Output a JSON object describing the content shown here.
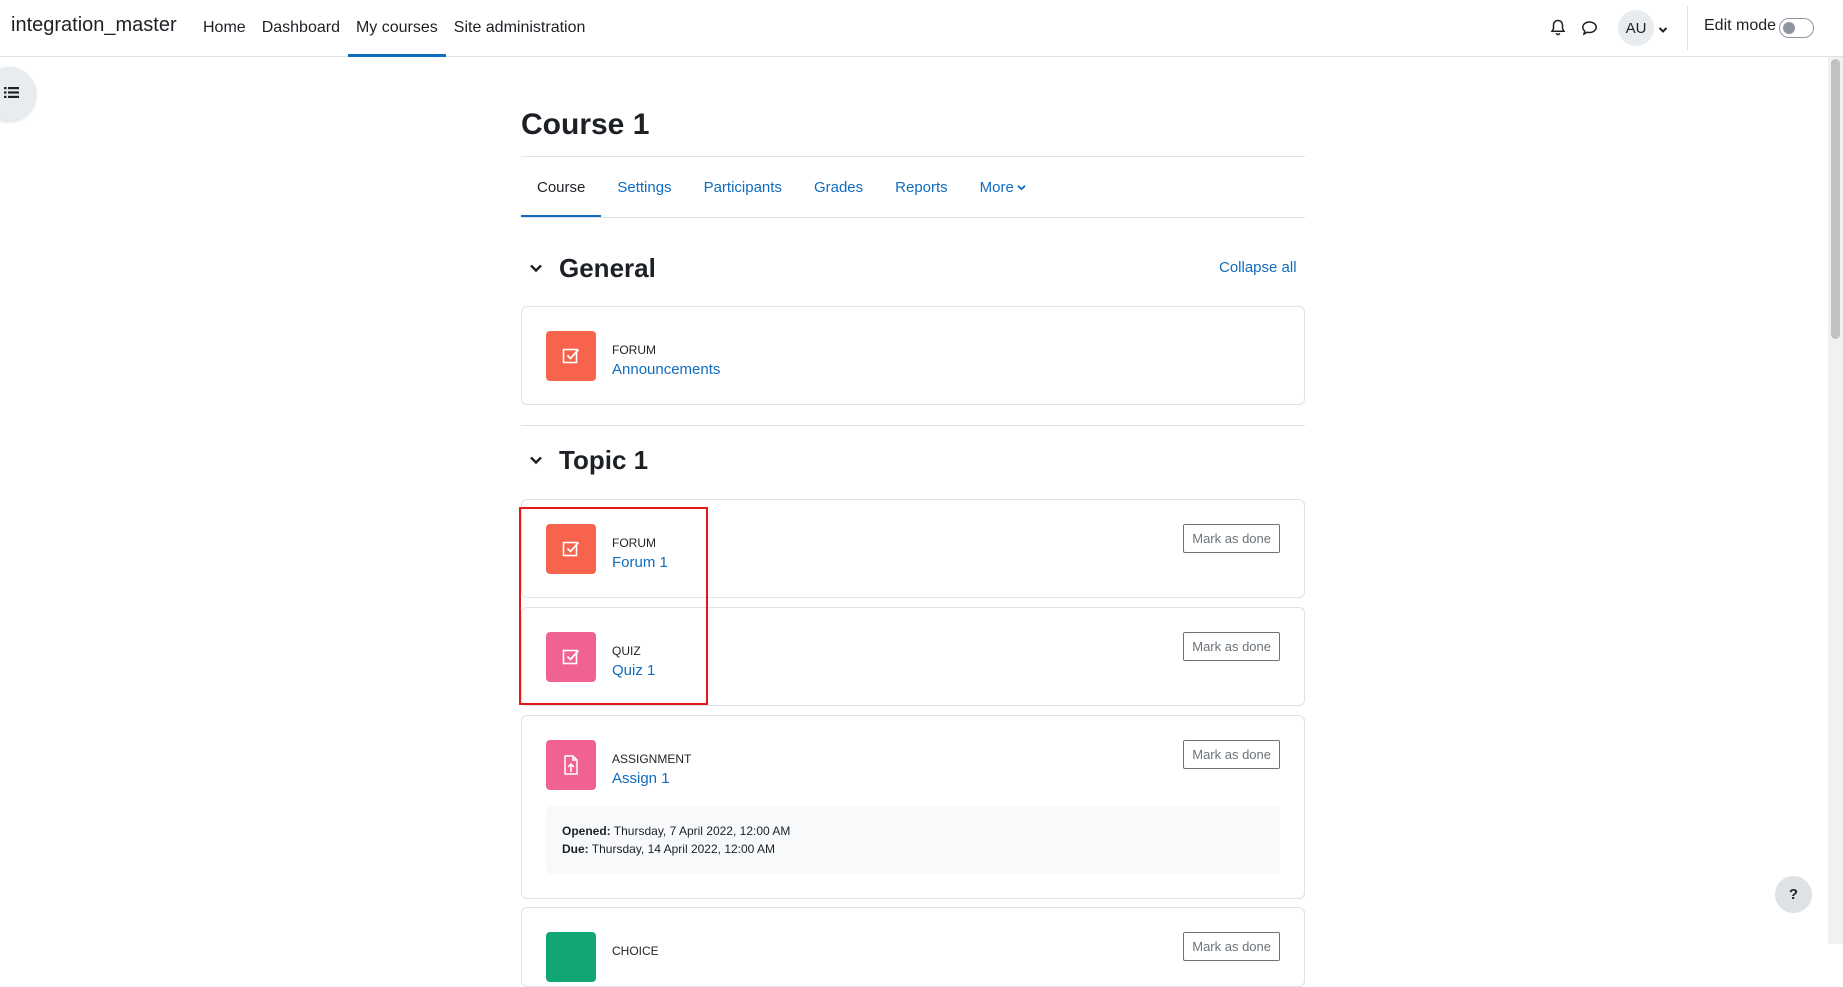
{
  "navbar": {
    "brand": "integration_master",
    "items": [
      {
        "label": "Home",
        "active": false
      },
      {
        "label": "Dashboard",
        "active": false
      },
      {
        "label": "My courses",
        "active": true
      },
      {
        "label": "Site administration",
        "active": false
      }
    ],
    "avatar_initials": "AU",
    "edit_mode_label": "Edit mode",
    "edit_mode_on": false,
    "icons": [
      "bell-icon",
      "chat-icon",
      "chevron-down-icon"
    ]
  },
  "course": {
    "title": "Course 1",
    "tabs": [
      {
        "label": "Course",
        "active": true
      },
      {
        "label": "Settings",
        "active": false
      },
      {
        "label": "Participants",
        "active": false
      },
      {
        "label": "Grades",
        "active": false
      },
      {
        "label": "Reports",
        "active": false
      },
      {
        "label": "More",
        "active": false
      }
    ]
  },
  "collapse_all_label": "Collapse all",
  "sections": [
    {
      "title": "General",
      "activities": [
        {
          "type": "FORUM",
          "name": "Announcements",
          "icon": "forum-icon",
          "color": "#f7634d"
        }
      ]
    },
    {
      "title": "Topic 1",
      "activities": [
        {
          "type": "FORUM",
          "name": "Forum 1",
          "icon": "forum-icon",
          "color": "#f7634d",
          "button": "Mark as done"
        },
        {
          "type": "QUIZ",
          "name": "Quiz 1",
          "icon": "quiz-icon",
          "color": "#f06292",
          "button": "Mark as done"
        },
        {
          "type": "ASSIGNMENT",
          "name": "Assign 1",
          "icon": "assignment-icon",
          "color": "#f06292",
          "button": "Mark as done",
          "dates": {
            "opened_label": "Opened:",
            "opened": "Thursday, 7 April 2022, 12:00 AM",
            "due_label": "Due:",
            "due": "Thursday, 14 April 2022, 12:00 AM"
          }
        },
        {
          "type": "CHOICE",
          "name": "",
          "icon": "choice-icon",
          "color": "#11a676",
          "button": "Mark as done"
        }
      ]
    }
  ],
  "help_label": "?"
}
